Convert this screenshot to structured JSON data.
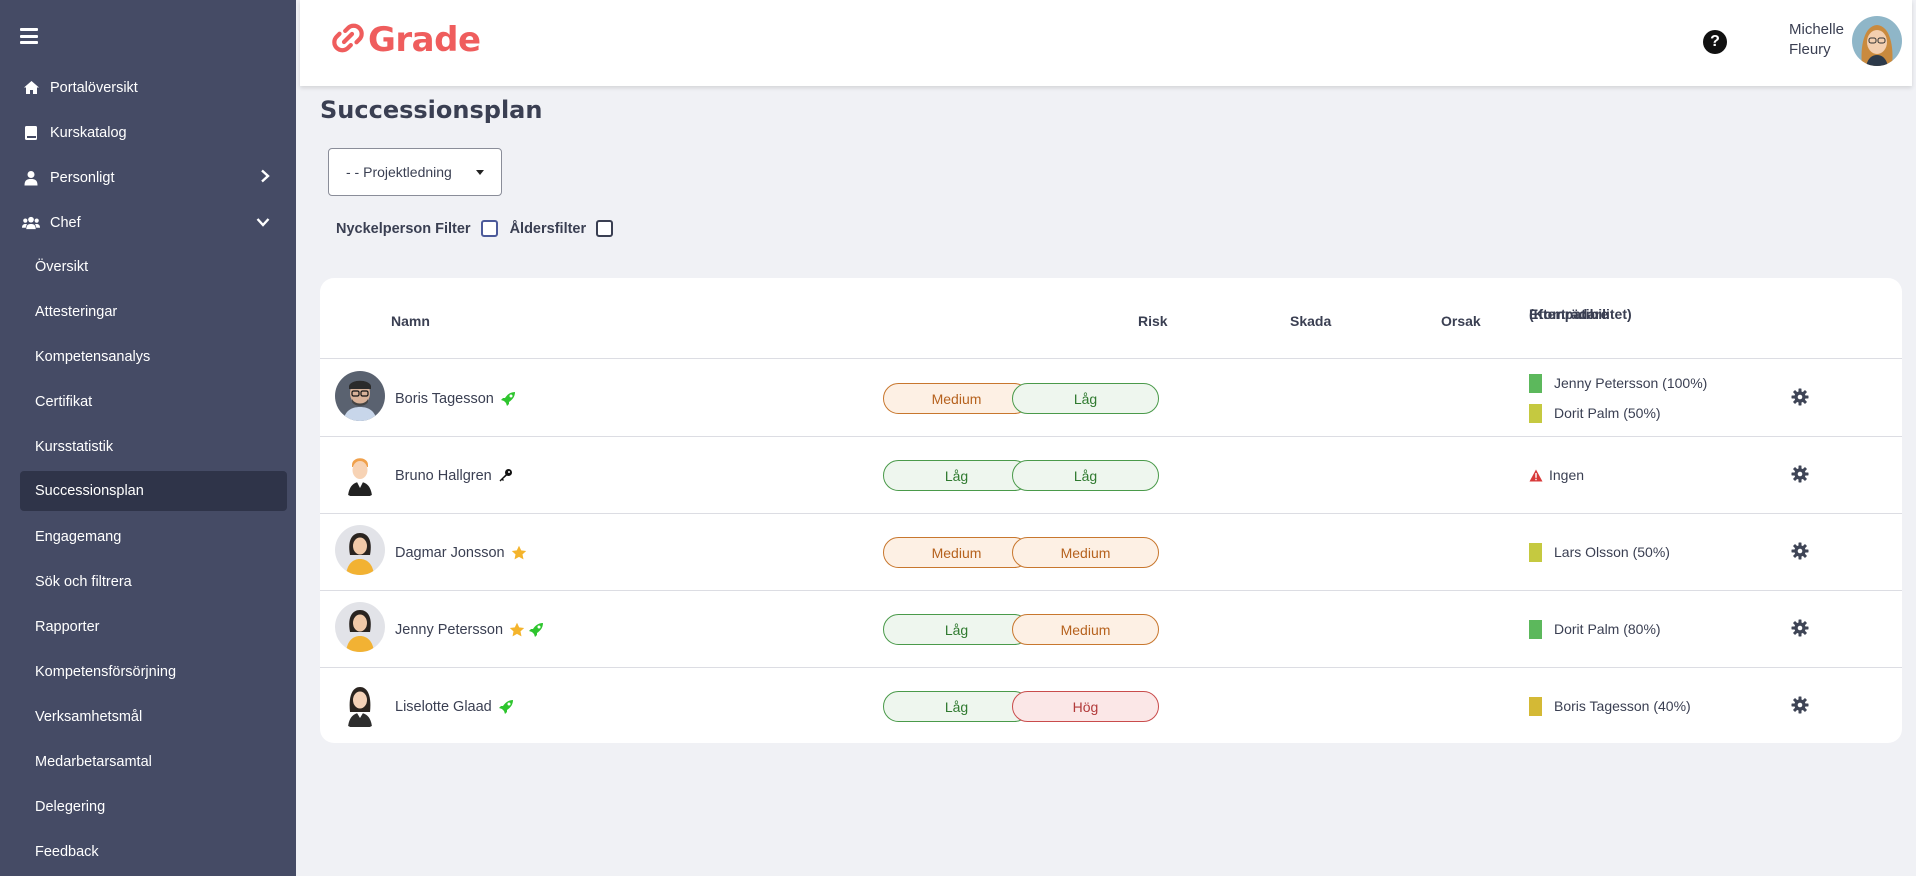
{
  "sidebar": {
    "nav": [
      {
        "label": "Portalöversikt",
        "icon": "home-icon"
      },
      {
        "label": "Kurskatalog",
        "icon": "book-icon"
      },
      {
        "label": "Personligt",
        "icon": "user-icon",
        "chevron": "chevron-right-icon"
      },
      {
        "label": "Chef",
        "icon": "users-icon",
        "chevron": "chevron-down-icon"
      }
    ],
    "sub_items": [
      {
        "label": "Översikt"
      },
      {
        "label": "Attesteringar"
      },
      {
        "label": "Kompetensanalys"
      },
      {
        "label": "Certifikat"
      },
      {
        "label": "Kursstatistik"
      },
      {
        "label": "Successionsplan",
        "active": true
      },
      {
        "label": "Engagemang"
      },
      {
        "label": "Sök och filtrera"
      },
      {
        "label": "Rapporter"
      },
      {
        "label": "Kompetensförsörjning"
      },
      {
        "label": "Verksamhetsmål"
      },
      {
        "label": "Medarbetarsamtal"
      },
      {
        "label": "Delegering"
      },
      {
        "label": "Feedback"
      }
    ]
  },
  "header": {
    "logo_text": "Grade",
    "brand_color": "#ef5d5d",
    "user_first": "Michelle",
    "user_last": "Fleury"
  },
  "page": {
    "title": "Successionsplan",
    "select_value": "- - Projektledning",
    "filter_key_person": "Nyckelperson Filter",
    "filter_age": "Åldersfilter"
  },
  "table": {
    "headers": {
      "name": "Namn",
      "risk": "Risk",
      "damage": "Skada",
      "reason": "Orsak",
      "successor_line1": "Efterträdare",
      "successor_line2": "(Kompatibilitet)"
    },
    "rows": [
      {
        "name": "Boris Tagesson",
        "tags": [
          "rocket-icon"
        ],
        "risk": "Medium",
        "risk_level": "medium",
        "damage": "Låg",
        "damage_level": "low",
        "successors": [
          {
            "text": "Jenny Petersson (100%)",
            "color": "#5cb85c"
          },
          {
            "text": "Dorit Palm (50%)",
            "color": "#c5c940"
          }
        ]
      },
      {
        "name": "Bruno Hallgren",
        "tags": [
          "key-icon"
        ],
        "risk": "Låg",
        "risk_level": "low",
        "damage": "Låg",
        "damage_level": "low",
        "successors": [
          {
            "text": "Ingen",
            "warning": true
          }
        ]
      },
      {
        "name": "Dagmar Jonsson",
        "tags": [
          "star-icon"
        ],
        "risk": "Medium",
        "risk_level": "medium",
        "damage": "Medium",
        "damage_level": "medium",
        "successors": [
          {
            "text": "Lars Olsson (50%)",
            "color": "#c5c940"
          }
        ]
      },
      {
        "name": "Jenny Petersson",
        "tags": [
          "star-icon",
          "rocket-icon"
        ],
        "risk": "Låg",
        "risk_level": "low",
        "damage": "Medium",
        "damage_level": "medium",
        "successors": [
          {
            "text": "Dorit Palm (80%)",
            "color": "#5cb85c"
          }
        ]
      },
      {
        "name": "Liselotte Glaad",
        "tags": [
          "rocket-icon"
        ],
        "risk": "Låg",
        "risk_level": "low",
        "damage": "Hög",
        "damage_level": "high",
        "successors": [
          {
            "text": "Boris Tagesson (40%)",
            "color": "#d4b935"
          }
        ]
      }
    ]
  }
}
